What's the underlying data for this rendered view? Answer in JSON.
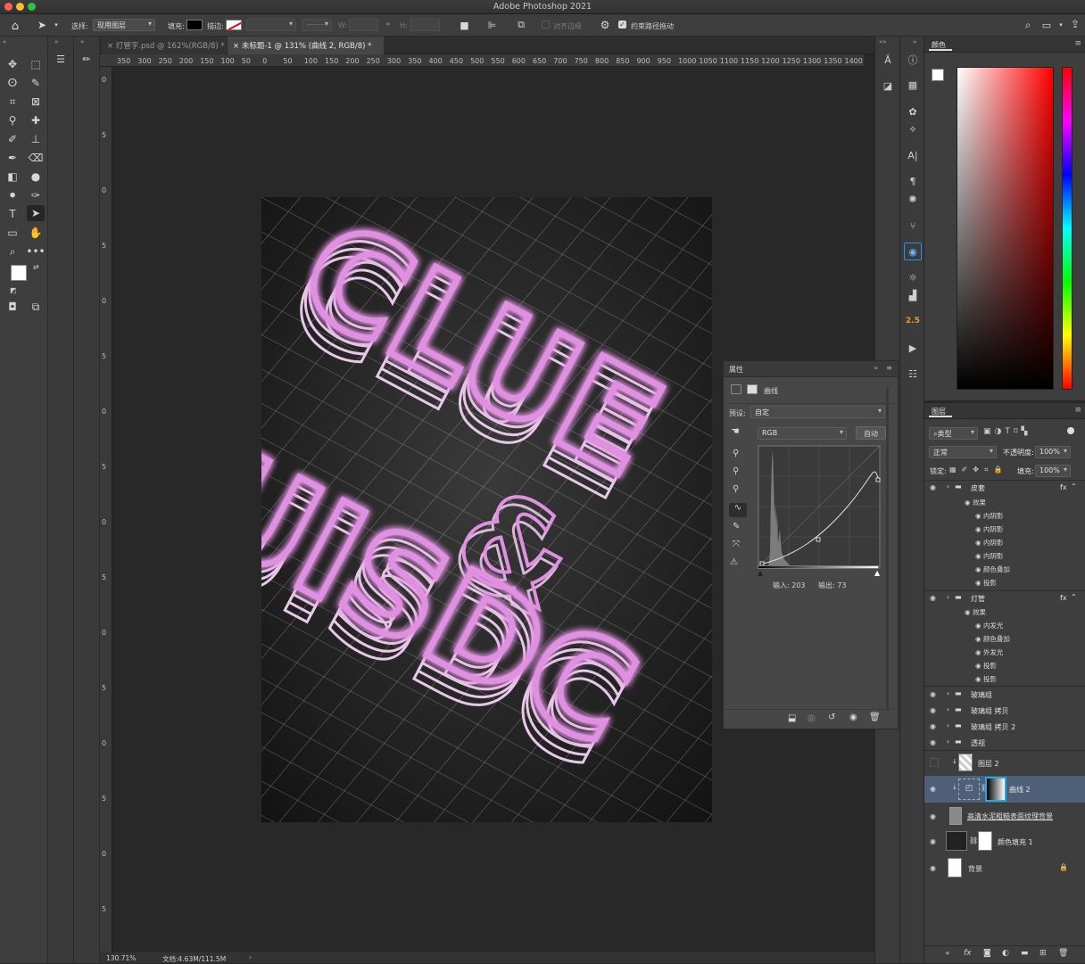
{
  "app": {
    "title": "Adobe Photoshop 2021"
  },
  "options": {
    "select_label": "选择:",
    "select_value": "现用图层",
    "fill_label": "填充:",
    "stroke_label": "描边:",
    "w_label": "W:",
    "h_label": "H:",
    "align_edges": "对齐边缘",
    "constrain_path": "约束路径拖动"
  },
  "tabs": [
    {
      "label": "灯管字.psd @ 162%(RGB/8) *"
    },
    {
      "label": "未标题-1 @ 131% (曲线 2, RGB/8) *"
    }
  ],
  "ruler": {
    "h_ticks": [
      "350",
      "300",
      "250",
      "200",
      "150",
      "100",
      "50",
      "0",
      "50",
      "100",
      "150",
      "200",
      "250",
      "300",
      "350",
      "400",
      "450",
      "500",
      "550",
      "600",
      "650",
      "700",
      "750",
      "800",
      "850",
      "900",
      "950",
      "1000",
      "1050",
      "1100",
      "1150",
      "1200",
      "1250",
      "1300",
      "1350",
      "1400"
    ],
    "v_ticks": [
      "0",
      "5",
      "0",
      "5",
      "0",
      "5",
      "0",
      "5",
      "0",
      "5",
      "0",
      "5",
      "0",
      "5",
      "0",
      "5"
    ]
  },
  "artwork": {
    "line1": "CLUE",
    "amp": "&",
    "line2": "UISDC"
  },
  "status": {
    "zoom": "130.71%",
    "doc": "文档:4.63M/111.5M"
  },
  "midicons": {
    "num": "2.5"
  },
  "properties": {
    "title": "属性",
    "type": "曲线",
    "preset_label": "预设:",
    "preset_value": "自定",
    "channel": "RGB",
    "auto": "自动",
    "input_label": "输入: 203",
    "output_label": "输出: 73"
  },
  "color": {
    "title": "颜色"
  },
  "layers": {
    "title": "图层",
    "filter": "类型",
    "blend": "正常",
    "opacity_label": "不透明度:",
    "opacity": "100%",
    "lock_label": "锁定:",
    "fill_label": "填充:",
    "fill": "100%",
    "items": [
      {
        "name": "皮套",
        "fx": "fx"
      },
      {
        "name": "效果"
      },
      {
        "name": "内阴影"
      },
      {
        "name": "内阴影"
      },
      {
        "name": "内阴影"
      },
      {
        "name": "内阴影"
      },
      {
        "name": "颜色叠加"
      },
      {
        "name": "投影"
      },
      {
        "name": "灯管",
        "fx": "fx"
      },
      {
        "name": "效果"
      },
      {
        "name": "内发光"
      },
      {
        "name": "颜色叠加"
      },
      {
        "name": "外发光"
      },
      {
        "name": "投影"
      },
      {
        "name": "投影"
      },
      {
        "name": "玻璃组"
      },
      {
        "name": "玻璃组 拷贝"
      },
      {
        "name": "玻璃组 拷贝 2"
      },
      {
        "name": "透视"
      },
      {
        "name": "图层 2"
      },
      {
        "name": "曲线 2"
      },
      {
        "name": "高清水泥粗糙表面纹理背景"
      },
      {
        "name": "颜色填充 1"
      },
      {
        "name": "背景"
      }
    ]
  }
}
